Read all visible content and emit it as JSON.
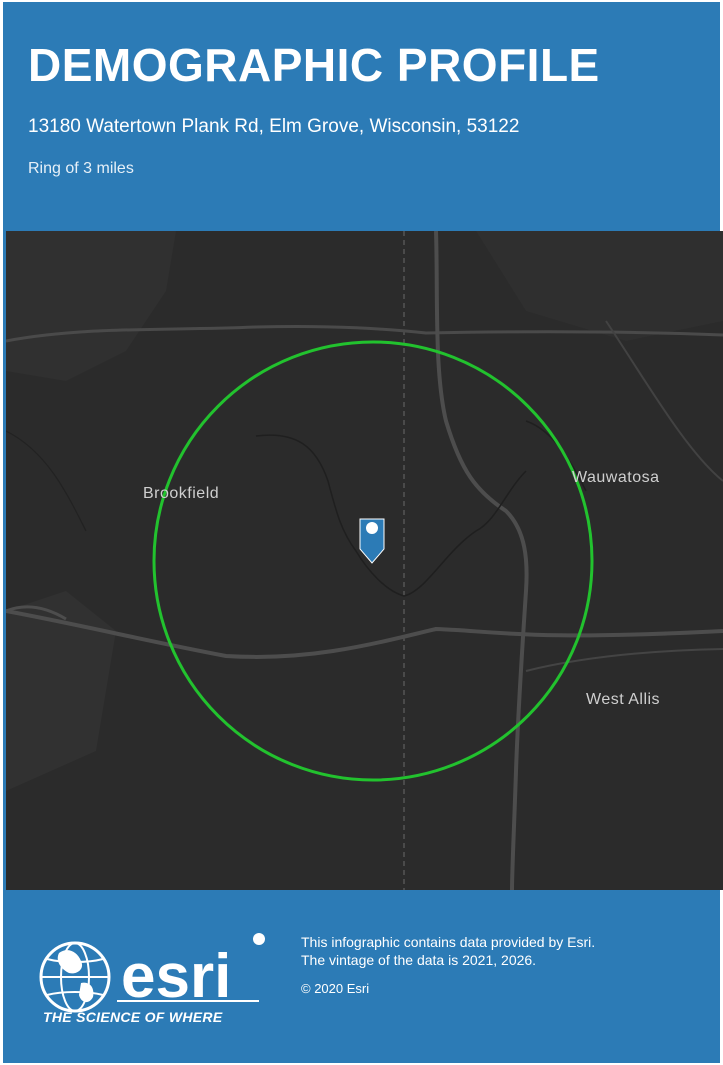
{
  "header": {
    "title": "DEMOGRAPHIC PROFILE",
    "address": "13180 Watertown Plank Rd, Elm Grove, Wisconsin, 53122",
    "ring": "Ring of 3 miles"
  },
  "map": {
    "places": {
      "brookfield": "Brookfield",
      "wauwatosa": "Wauwatosa",
      "west_allis": "West Allis"
    },
    "ring_radius_miles": 3,
    "colors": {
      "background": "#2b2b2b",
      "roads": "#4a4a4a",
      "ring": "#22c22e",
      "marker": "#2c7bb6"
    },
    "marker_icon": "location-pin-icon"
  },
  "footer": {
    "brand": "esri",
    "tagline": "THE SCIENCE OF WHERE",
    "info_line1": "This infographic contains data provided by Esri.",
    "info_line2": "The vintage of the data is 2021, 2026.",
    "copyright": "© 2020 Esri"
  },
  "colors": {
    "primary": "#2c7bb6",
    "text": "#ffffff"
  }
}
